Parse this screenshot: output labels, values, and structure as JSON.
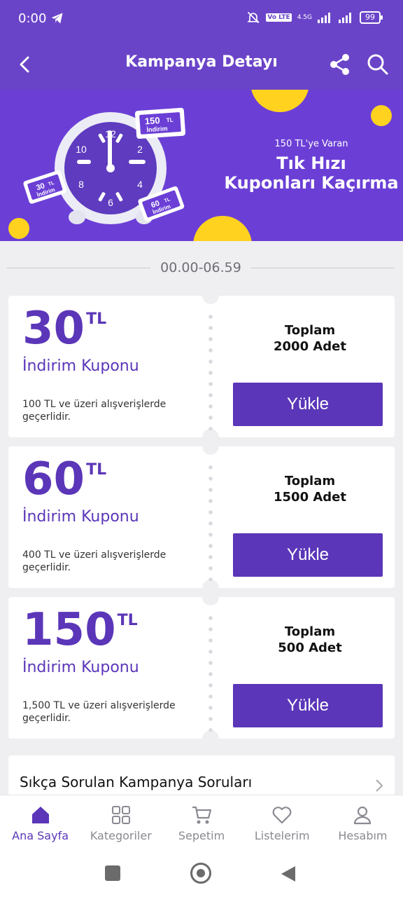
{
  "status_bar": {
    "time": "0:00",
    "network": "4.5G",
    "lte": "Vo LTE",
    "battery": "99"
  },
  "app_bar": {
    "title": "Kampanya Detayı"
  },
  "banner": {
    "subtitle": "150 TL'ye Varan",
    "headline_line1": "Tık Hızı",
    "headline_line2": "Kuponları Kaçırma",
    "tags": {
      "top_amount": "150",
      "top_unit": "TL",
      "top_label": "İndirim",
      "left_amount": "30",
      "left_unit": "TL",
      "left_label": "İndirim",
      "right_amount": "60",
      "right_unit": "TL",
      "right_label": "İndirim"
    },
    "clock_numbers": [
      "12",
      "2",
      "4",
      "6",
      "8",
      "10"
    ]
  },
  "time_range": "00.00-06.59",
  "coupons": [
    {
      "amount": "30",
      "unit": "TL",
      "label": "İndirim Kuponu",
      "condition": "100 TL ve üzeri alışverişlerde geçerlidir.",
      "total_line1": "Toplam",
      "total_line2": "2000 Adet",
      "button": "Yükle"
    },
    {
      "amount": "60",
      "unit": "TL",
      "label": "İndirim Kuponu",
      "condition": "400 TL ve üzeri alışverişlerde geçerlidir.",
      "total_line1": "Toplam",
      "total_line2": "1500 Adet",
      "button": "Yükle"
    },
    {
      "amount": "150",
      "unit": "TL",
      "label": "İndirim Kuponu",
      "condition": "1,500 TL ve üzeri alışverişlerde geçerlidir.",
      "total_line1": "Toplam",
      "total_line2": "500 Adet",
      "button": "Yükle"
    }
  ],
  "faq": {
    "title": "Sıkça Sorulan Kampanya Soruları"
  },
  "bottom_nav": [
    {
      "label": "Ana Sayfa",
      "icon": "home-icon",
      "active": true
    },
    {
      "label": "Kategoriler",
      "icon": "grid-icon",
      "active": false
    },
    {
      "label": "Sepetim",
      "icon": "cart-icon",
      "active": false
    },
    {
      "label": "Listelerim",
      "icon": "heart-icon",
      "active": false
    },
    {
      "label": "Hesabım",
      "icon": "user-icon",
      "active": false
    }
  ],
  "colors": {
    "primary": "#6a44c8",
    "accent_purple": "#5b36b8",
    "banner_bg": "#6b3fd6",
    "banner_yellow": "#ffd21f",
    "page_bg": "#efeff1"
  }
}
